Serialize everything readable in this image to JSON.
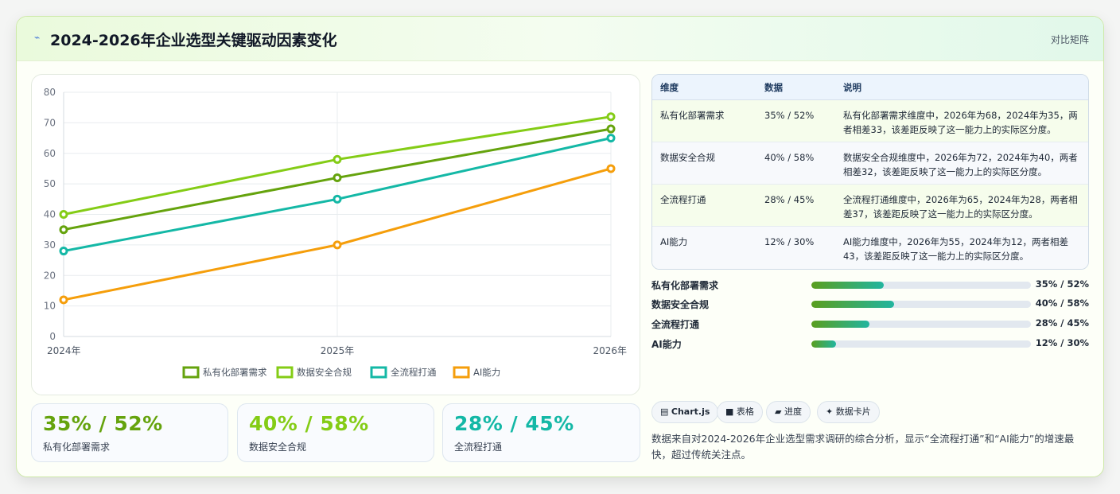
{
  "header": {
    "icon": "trend-icon",
    "title": "2024-2026年企业选型关键驱动因素变化",
    "mode_label": "对比矩阵"
  },
  "chart_data": {
    "type": "line",
    "x": [
      "2024年",
      "2025年",
      "2026年"
    ],
    "ylim": [
      0,
      80
    ],
    "yticks": [
      0,
      10,
      20,
      30,
      40,
      50,
      60,
      70,
      80
    ],
    "grid": true,
    "legend": "bottom",
    "series": [
      {
        "name": "私有化部署需求",
        "values": [
          35,
          52,
          68
        ],
        "color": "#65a30d"
      },
      {
        "name": "数据安全合规",
        "values": [
          40,
          58,
          72
        ],
        "color": "#84cc16"
      },
      {
        "name": "全流程打通",
        "values": [
          28,
          45,
          65
        ],
        "color": "#14b8a6"
      },
      {
        "name": "AI能力",
        "values": [
          12,
          30,
          55
        ],
        "color": "#f59e0b"
      }
    ]
  },
  "kpis": [
    {
      "value": "35% / 52%",
      "label": "私有化部署需求",
      "color": "#65a30d"
    },
    {
      "value": "40% / 58%",
      "label": "数据安全合规",
      "color": "#84cc16"
    },
    {
      "value": "28% / 45%",
      "label": "全流程打通",
      "color": "#14b8a6"
    }
  ],
  "table": {
    "headers": [
      "维度",
      "数据",
      "说明"
    ],
    "rows": [
      {
        "dim": "私有化部署需求",
        "data": "35% / 52%",
        "desc": "私有化部署需求维度中，2026年为68，2024年为35，两者相差33，该差距反映了这一能力上的实际区分度。"
      },
      {
        "dim": "数据安全合规",
        "data": "40% / 58%",
        "desc": "数据安全合规维度中，2026年为72，2024年为40，两者相差32，该差距反映了这一能力上的实际区分度。"
      },
      {
        "dim": "全流程打通",
        "data": "28% / 45%",
        "desc": "全流程打通维度中，2026年为65，2024年为28，两者相差37，该差距反映了这一能力上的实际区分度。"
      },
      {
        "dim": "AI能力",
        "data": "12% / 30%",
        "desc": "AI能力维度中，2026年为55，2024年为12，两者相差43，该差距反映了这一能力上的实际区分度。"
      }
    ]
  },
  "progress": [
    {
      "label": "私有化部署需求",
      "value": "35% / 52%",
      "fraction": 0.33
    },
    {
      "label": "数据安全合规",
      "value": "40% / 58%",
      "fraction": 0.376
    },
    {
      "label": "全流程打通",
      "value": "28% / 45%",
      "fraction": 0.264
    },
    {
      "label": "AI能力",
      "value": "12% / 30%",
      "fraction": 0.114
    }
  ],
  "chips": [
    {
      "icon": "chart-icon",
      "glyph": "▤",
      "label": "Chart.js"
    },
    {
      "icon": "table-icon",
      "glyph": "■",
      "label": "表格"
    },
    {
      "icon": "progress-icon",
      "glyph": "▰",
      "label": "进度"
    },
    {
      "icon": "card-icon",
      "glyph": "✦",
      "label": "数据卡片"
    }
  ],
  "note": "数据来自对2024-2026年企业选型需求调研的综合分析，显示“全流程打通”和“AI能力”的增速最快，超过传统关注点。"
}
